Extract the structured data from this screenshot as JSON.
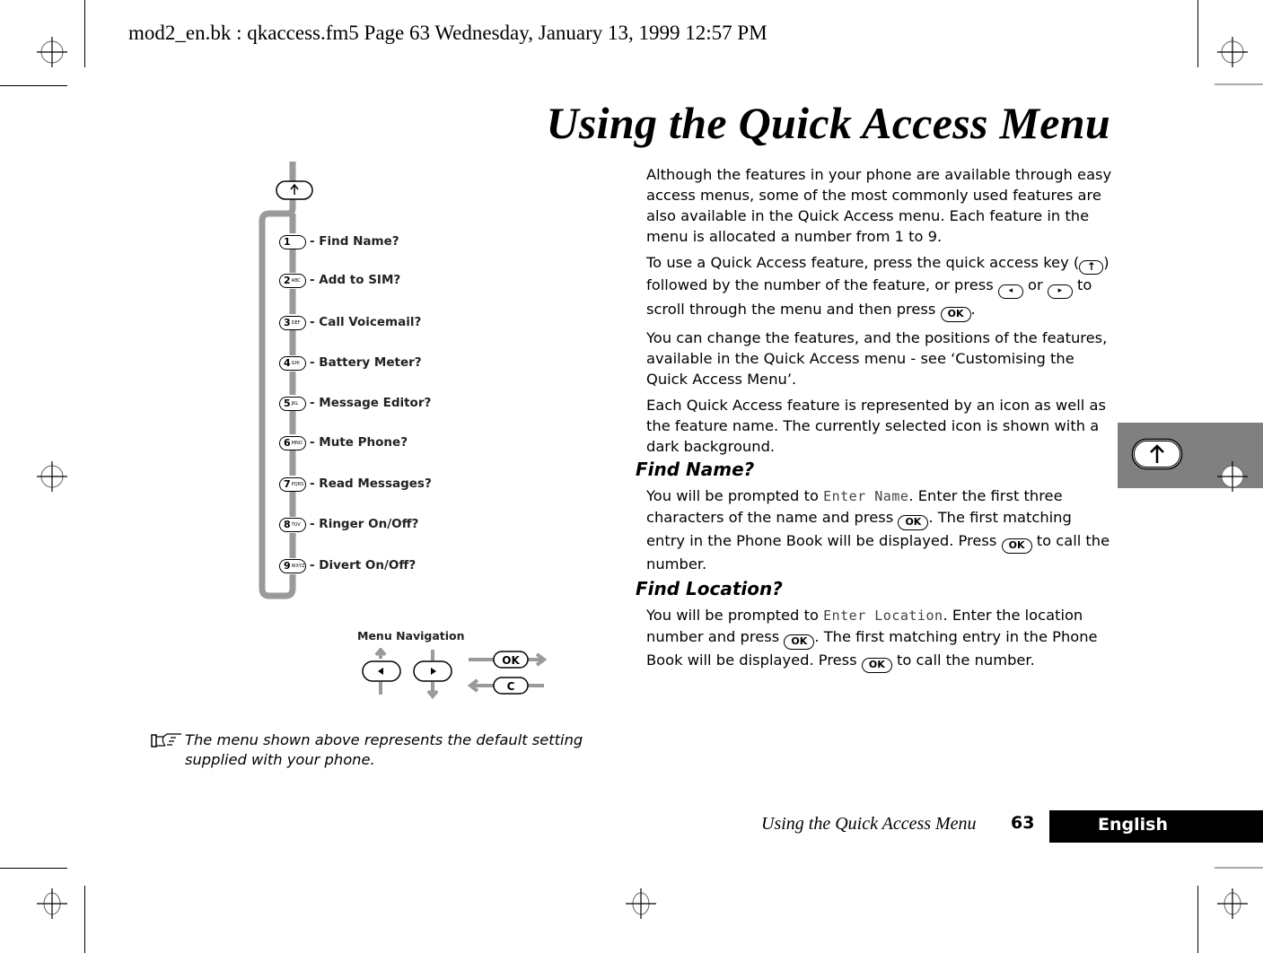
{
  "print_header": "mod2_en.bk : qkaccess.fm5  Page 63  Wednesday, January 13, 1999  12:57 PM",
  "page_title": "Using the Quick Access Menu",
  "diagram": {
    "quick_access_key": "↑",
    "items": [
      {
        "key": "1",
        "letters": "",
        "label": "- Find Name?"
      },
      {
        "key": "2",
        "letters": "ABC",
        "label": "- Add to SIM?"
      },
      {
        "key": "3",
        "letters": "DEF",
        "label": "- Call Voicemail?"
      },
      {
        "key": "4",
        "letters": "GHI",
        "label": "- Battery Meter?"
      },
      {
        "key": "5",
        "letters": "JKL",
        "label": "- Message Editor?"
      },
      {
        "key": "6",
        "letters": "MNO",
        "label": "- Mute Phone?"
      },
      {
        "key": "7",
        "letters": "PQRS",
        "label": "- Read Messages?"
      },
      {
        "key": "8",
        "letters": "TUV",
        "label": "- Ringer On/Off?"
      },
      {
        "key": "9",
        "letters": "WXYZ",
        "label": "- Divert On/Off?"
      }
    ],
    "navigation_caption": "Menu Navigation",
    "nav_keys": {
      "left": "◂",
      "right": "▸",
      "ok": "OK",
      "clear": "C"
    }
  },
  "note": "The menu shown above represents the default setting supplied with your phone.",
  "intro": {
    "p1": "Although the features in your phone are available through easy access menus, some of the most commonly used features are also available in the Quick Access menu. Each feature in the menu is allocated a number from 1 to 9.",
    "p2_a": "To use a Quick Access feature, press the quick access key (",
    "p2_b": ") followed by the number of the feature, or press ",
    "p2_c": " or ",
    "p2_d": " to scroll through the menu and then press ",
    "p2_e": ".",
    "p3": "You can change the features, and the positions of the features, available in the Quick Access menu - see ‘Customising the Quick Access Menu’.",
    "p4": "Each Quick Access feature is represented by an icon as well as the feature name. The currently selected icon is shown with a dark background."
  },
  "sections": [
    {
      "heading": "Find Name?",
      "t1": "You will be prompted to ",
      "lcd": "Enter Name",
      "t2": ". Enter the first three characters of the name and press ",
      "t3": ". The first matching entry in the Phone Book will be displayed. Press ",
      "t4": " to call the number."
    },
    {
      "heading": "Find Location?",
      "t1": "You will be prompted to ",
      "lcd": "Enter Location",
      "t2": ". Enter the location number and press ",
      "t3": ". The first matching entry in the Phone Book will be displayed. Press ",
      "t4": " to call the number."
    }
  ],
  "keys": {
    "ok": "OK",
    "up": "↑",
    "left": "◂",
    "right": "▸"
  },
  "side_tab_icon": "↑",
  "footer": {
    "title": "Using the Quick Access Menu",
    "page_number": "63",
    "language": "English"
  }
}
